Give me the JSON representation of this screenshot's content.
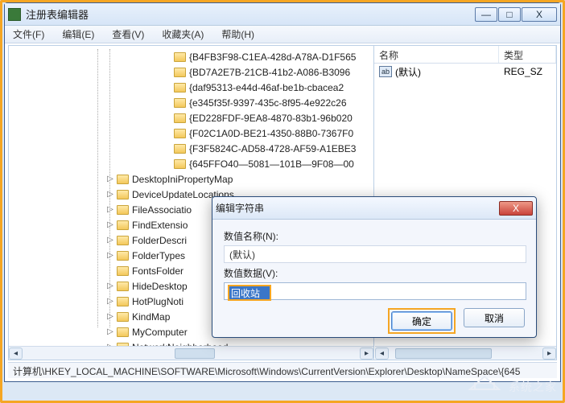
{
  "window": {
    "title": "注册表编辑器",
    "buttons": {
      "min": "—",
      "max": "□",
      "close": "X"
    }
  },
  "menu": [
    "文件(F)",
    "编辑(E)",
    "查看(V)",
    "收藏夹(A)",
    "帮助(H)"
  ],
  "tree": {
    "guid_items": [
      "{B4FB3F98-C1EA-428d-A78A-D1F565",
      "{BD7A2E7B-21CB-41b2-A086-B3096",
      "{daf95313-e44d-46af-be1b-cbacea2",
      "{e345f35f-9397-435c-8f95-4e922c26",
      "{ED228FDF-9EA8-4870-83b1-96b020",
      "{F02C1A0D-BE21-4350-88B0-7367F0",
      "{F3F5824C-AD58-4728-AF59-A1EBE3"
    ],
    "guid_selected": "{645FFO40—5081—101B—9F08—00",
    "child_items": [
      "DesktopIniPropertyMap",
      "DeviceUpdateLocations",
      "FileAssociatio",
      "FindExtensio",
      "FolderDescri",
      "FolderTypes",
      "FontsFolder",
      "HideDesktop",
      "HotPlugNoti",
      "KindMap",
      "MyComputer",
      "NetworkNeighborhood"
    ]
  },
  "list": {
    "col_name": "名称",
    "col_type": "类型",
    "row_icon_text": "ab",
    "row_name": "(默认)",
    "row_type": "REG_SZ"
  },
  "dialog": {
    "title": "编辑字符串",
    "name_label": "数值名称(N):",
    "name_value": "(默认)",
    "data_label": "数值数据(V):",
    "data_value": "回收站",
    "ok": "确定",
    "cancel": "取消",
    "close_glyph": "X"
  },
  "status": "计算机\\HKEY_LOCAL_MACHINE\\SOFTWARE\\Microsoft\\Windows\\CurrentVersion\\Explorer\\Desktop\\NameSpace\\{645",
  "watermark": "系统之家"
}
